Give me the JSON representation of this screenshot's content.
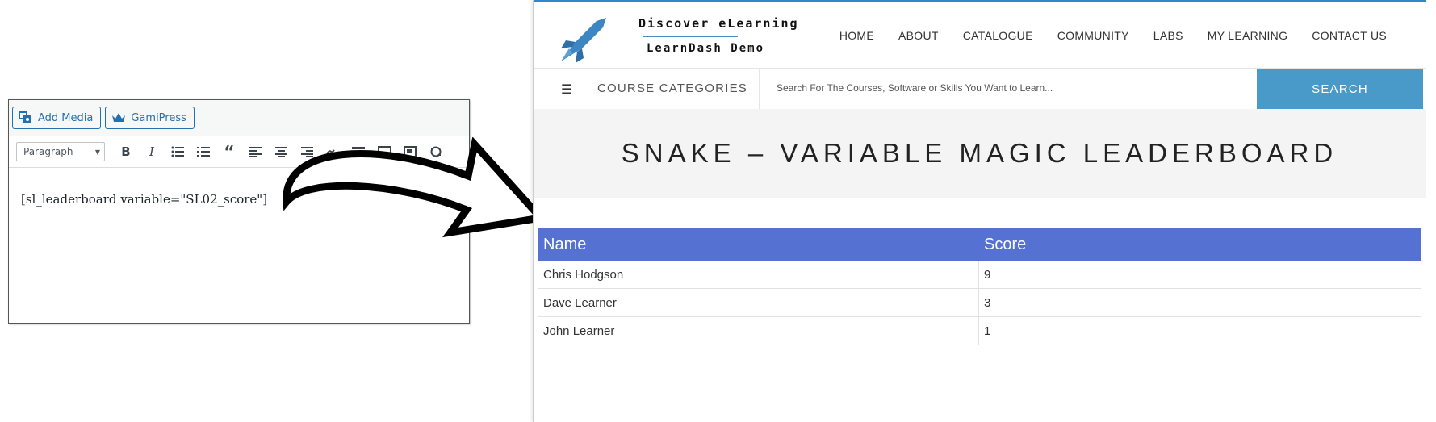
{
  "editor": {
    "media_buttons": [
      {
        "label": "Add Media",
        "icon": "add-media-icon"
      },
      {
        "label": "GamiPress",
        "icon": "crown-icon"
      }
    ],
    "format_select": "Paragraph",
    "toolbar_icons": [
      "bold-icon",
      "italic-icon",
      "bullet-list-icon",
      "numbered-list-icon",
      "blockquote-icon",
      "align-left-icon",
      "align-center-icon",
      "align-right-icon",
      "link-icon",
      "more-icon",
      "toolbar-toggle-icon",
      "fullscreen-icon",
      "undo-icon"
    ],
    "content": "[sl_leaderboard variable=\"SL02_score\"]"
  },
  "site": {
    "logo": {
      "line1": "Discover eLearning",
      "line2": "LearnDash Demo",
      "accent": "#4a90c8"
    },
    "nav": [
      "HOME",
      "ABOUT",
      "CATALOGUE",
      "COMMUNITY",
      "LABS",
      "MY LEARNING",
      "CONTACT US"
    ],
    "categories_label": "COURSE CATEGORIES",
    "search": {
      "placeholder": "Search For The Courses, Software or Skills You Want to Learn...",
      "button": "SEARCH"
    },
    "page_title": "SNAKE – VARIABLE MAGIC LEADERBOARD",
    "leaderboard": {
      "headers": [
        "Name",
        "Score"
      ],
      "rows": [
        {
          "name": "Chris Hodgson",
          "score": "9"
        },
        {
          "name": "Dave Learner",
          "score": "3"
        },
        {
          "name": "John Learner",
          "score": "1"
        }
      ]
    },
    "colors": {
      "header_blue": "#5571d1",
      "search_blue": "#4a9ac9"
    }
  }
}
